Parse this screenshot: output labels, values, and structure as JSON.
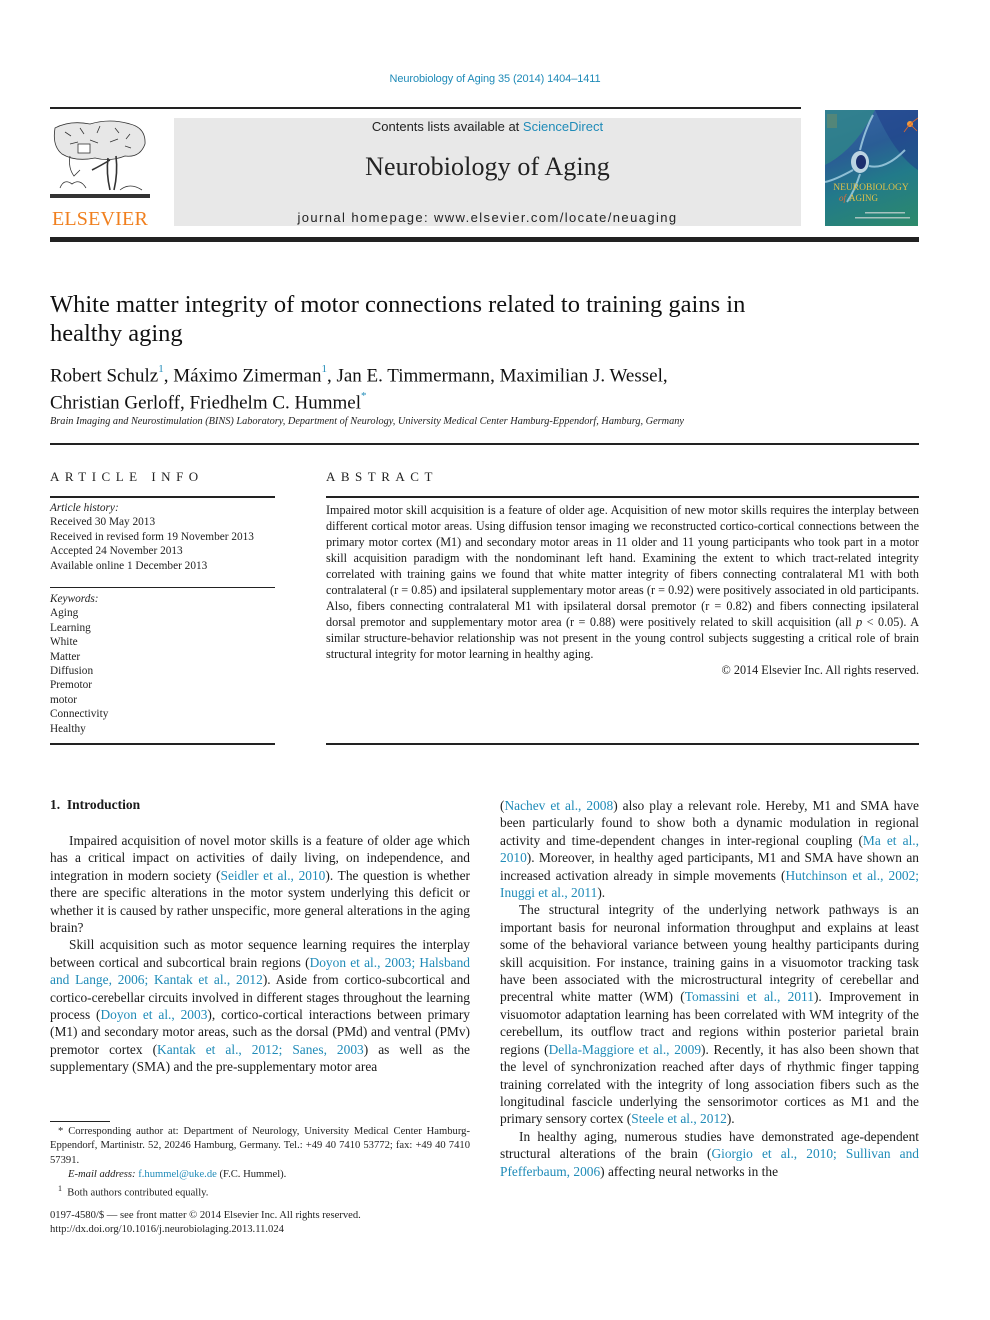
{
  "header": {
    "citation": "Neurobiology of Aging 35 (2014) 1404–1411",
    "contents_prefix": "Contents lists available at ",
    "contents_link": "ScienceDirect",
    "journal_name": "Neurobiology of Aging",
    "homepage": "journal homepage: www.elsevier.com/locate/neuaging",
    "publisher_wordmark": "ELSEVIER",
    "cover_title_line1": "NEUROBIOLOGY",
    "cover_title_line2": "AGING",
    "cover_title_of": "of"
  },
  "article": {
    "title": "White matter integrity of motor connections related to training gains in healthy aging",
    "authors": [
      {
        "name": "Robert Schulz",
        "mark": "1",
        "sep": ", "
      },
      {
        "name": "Máximo Zimerman",
        "mark": "1",
        "sep": ", "
      },
      {
        "name": "Jan E. Timmermann",
        "mark": "",
        "sep": ", "
      },
      {
        "name": "Maximilian J. Wessel",
        "mark": "",
        "sep": ","
      },
      {
        "name": "Christian Gerloff",
        "mark": "",
        "sep": ", "
      },
      {
        "name": "Friedhelm C. Hummel",
        "mark": "*",
        "sep": ""
      }
    ],
    "affiliation": "Brain Imaging and Neurostimulation (BINS) Laboratory, Department of Neurology, University Medical Center Hamburg-Eppendorf, Hamburg, Germany"
  },
  "article_info": {
    "heading": "ARTICLE INFO",
    "history_label": "Article history:",
    "history": [
      "Received 30 May 2013",
      "Received in revised form 19 November 2013",
      "Accepted 24 November 2013",
      "Available online 1 December 2013"
    ],
    "keywords_label": "Keywords:",
    "keywords": [
      "Aging",
      "Learning",
      "White",
      "Matter",
      "Diffusion",
      "Premotor",
      "motor",
      "Connectivity",
      "Healthy"
    ]
  },
  "abstract": {
    "heading": "ABSTRACT",
    "text_1": "Impaired motor skill acquisition is a feature of older age. Acquisition of new motor skills requires the interplay between different cortical motor areas. Using diffusion tensor imaging we reconstructed cortico-cortical connections between the primary motor cortex (M1) and secondary motor areas in 11 older and 11 young participants who took part in a motor skill acquisition paradigm with the nondominant left hand. Examining the extent to which tract-related integrity correlated with training gains we found that white matter integrity of fibers connecting contralateral M1 with both contralateral (r = 0.85) and ipsilateral supplementary motor areas (r = 0.92) were positively associated in old participants. Also, fibers connecting contralateral M1 with ipsilateral dorsal premotor (r = 0.82) and fibers connecting ipsilateral dorsal premotor and supplementary motor area (r = 0.88) were positively related to skill acquisition (all ",
    "p_symbol": "p",
    "text_2": " < 0.05). A similar structure-behavior relationship was not present in the young control subjects suggesting a critical role of brain structural integrity for motor learning in healthy aging.",
    "copyright": "© 2014 Elsevier Inc. All rights reserved."
  },
  "introduction": {
    "heading": "1.  Introduction",
    "left_paragraphs": [
      [
        {
          "t": "Impaired acquisition of novel motor skills is a feature of older age which has a critical impact on activities of daily living, on independence, and integration in modern society ("
        },
        {
          "t": "Seidler et al., 2010",
          "link": true
        },
        {
          "t": "). The question is whether there are specific alterations in the motor system underlying this deficit or whether it is caused by rather unspecific, more general alterations in the aging brain?"
        }
      ],
      [
        {
          "t": "Skill acquisition such as motor sequence learning requires the interplay between cortical and subcortical brain regions ("
        },
        {
          "t": "Doyon et al., 2003; Halsband and Lange, 2006; Kantak et al., 2012",
          "link": true
        },
        {
          "t": "). Aside from cortico-subcortical and cortico-cerebellar circuits involved in different stages throughout the learning process ("
        },
        {
          "t": "Doyon et al., 2003",
          "link": true
        },
        {
          "t": "), cortico-cortical interactions between primary (M1) and secondary motor areas, such as the dorsal (PMd) and ventral (PMv) premotor cortex ("
        },
        {
          "t": "Kantak et al., 2012; Sanes, 2003",
          "link": true
        },
        {
          "t": ") as well as the supplementary (SMA) and the pre-supplementary motor area"
        }
      ]
    ],
    "right_paragraphs": [
      [
        {
          "t": "("
        },
        {
          "t": "Nachev et al., 2008",
          "link": true
        },
        {
          "t": ") also play a relevant role. Hereby, M1 and SMA have been particularly found to show both a dynamic modulation in regional activity and time-dependent changes in inter-regional coupling ("
        },
        {
          "t": "Ma et al., 2010",
          "link": true
        },
        {
          "t": "). Moreover, in healthy aged participants, M1 and SMA have shown an increased activation already in simple movements ("
        },
        {
          "t": "Hutchinson et al., 2002; Inuggi et al., 2011",
          "link": true
        },
        {
          "t": ")."
        }
      ],
      [
        {
          "t": "The structural integrity of the underlying network pathways is an important basis for neuronal information throughput and explains at least some of the behavioral variance between young healthy participants during skill acquisition. For instance, training gains in a visuomotor tracking task have been associated with the microstructural integrity of cerebellar and precentral white matter (WM) ("
        },
        {
          "t": "Tomassini et al., 2011",
          "link": true
        },
        {
          "t": "). Improvement in visuomotor adaptation learning has been correlated with WM integrity of the cerebellum, its outflow tract and regions within posterior parietal brain regions ("
        },
        {
          "t": "Della-Maggiore et al., 2009",
          "link": true
        },
        {
          "t": "). Recently, it has also been shown that the level of synchronization reached after days of rhythmic finger tapping training correlated with the integrity of long association fibers such as the longitudinal fascicle underlying the sensorimotor cortices as M1 and the primary sensory cortex ("
        },
        {
          "t": "Steele et al., 2012",
          "link": true
        },
        {
          "t": ")."
        }
      ],
      [
        {
          "t": "In healthy aging, numerous studies have demonstrated age-dependent structural alterations of the brain ("
        },
        {
          "t": "Giorgio et al., 2010; Sullivan and Pfefferbaum, 2006",
          "link": true
        },
        {
          "t": ") affecting neural networks in the"
        }
      ]
    ]
  },
  "footnotes": {
    "corresponding": "* Corresponding author at: Department of Neurology, University Medical Center Hamburg-Eppendorf, Martinistr. 52, 20246 Hamburg, Germany. Tel.: +49 40 7410 53772; fax: +49 40 7410 57391.",
    "email_label": "E-mail address: ",
    "email": "f.hummel@uke.de",
    "email_suffix": " (F.C. Hummel).",
    "equal_mark": "1",
    "equal_text": "Both authors contributed equally.",
    "front_matter": "0197-4580/$ — see front matter © 2014 Elsevier Inc. All rights reserved.",
    "doi": "http://dx.doi.org/10.1016/j.neurobiolaging.2013.11.024"
  },
  "colors": {
    "link": "#1f8bb8",
    "elsevier_orange": "#f07f1e",
    "masthead_bg": "#e8e8e8"
  }
}
